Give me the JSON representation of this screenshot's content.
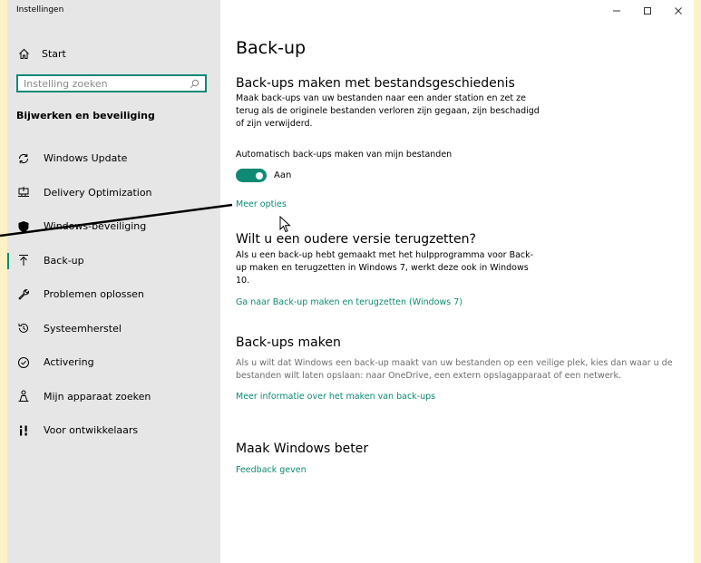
{
  "window": {
    "title": "Instellingen",
    "controls": {
      "minimize": "–",
      "maximize": "☐",
      "close": "✕"
    }
  },
  "sidebar": {
    "home_label": "Start",
    "search_placeholder": "Instelling zoeken",
    "section_title": "Bijwerken en beveiliging",
    "items": [
      {
        "label": "Windows Update",
        "icon": "sync-icon"
      },
      {
        "label": "Delivery Optimization",
        "icon": "delivery-icon"
      },
      {
        "label": "Windows-beveiliging",
        "icon": "shield-icon"
      },
      {
        "label": "Back-up",
        "icon": "backup-arrow-icon",
        "selected": true
      },
      {
        "label": "Problemen oplossen",
        "icon": "wrench-icon"
      },
      {
        "label": "Systeemherstel",
        "icon": "restore-icon"
      },
      {
        "label": "Activering",
        "icon": "check-circle-icon"
      },
      {
        "label": "Mijn apparaat zoeken",
        "icon": "person-location-icon"
      },
      {
        "label": "Voor ontwikkelaars",
        "icon": "developer-icon"
      }
    ]
  },
  "main": {
    "page_title": "Back-up",
    "file_history": {
      "heading": "Back-ups maken met bestandsgeschiedenis",
      "description": "Maak back-ups van uw bestanden naar een ander station en zet ze terug als de originele bestanden verloren zijn gegaan, zijn beschadigd of zijn verwijderd.",
      "auto_label": "Automatisch back-ups maken van mijn bestanden",
      "toggle_state": "Aan",
      "more_options": "Meer opties"
    },
    "older_version": {
      "heading": "Wilt u een oudere versie terugzetten?",
      "description": "Als u een back-up hebt gemaakt met het hulpprogramma voor Back-up maken en terugzetten in Windows 7, werkt deze ook in Windows 10.",
      "link": "Ga naar Back-up maken en terugzetten (Windows 7)"
    },
    "make_backups": {
      "heading": "Back-ups maken",
      "description": "Als u wilt dat Windows een back-up maakt van uw bestanden op een veilige plek, kies dan waar u de bestanden wilt laten opslaan: naar OneDrive, een extern opslagapparaat of een netwerk.",
      "link": "Meer informatie over het maken van back-ups"
    },
    "improve": {
      "heading": "Maak Windows beter",
      "link": "Feedback geven"
    }
  },
  "colors": {
    "accent": "#0e8a74",
    "sidebar_bg": "#e6e6e6",
    "frame_bg": "#fdf1c6"
  }
}
